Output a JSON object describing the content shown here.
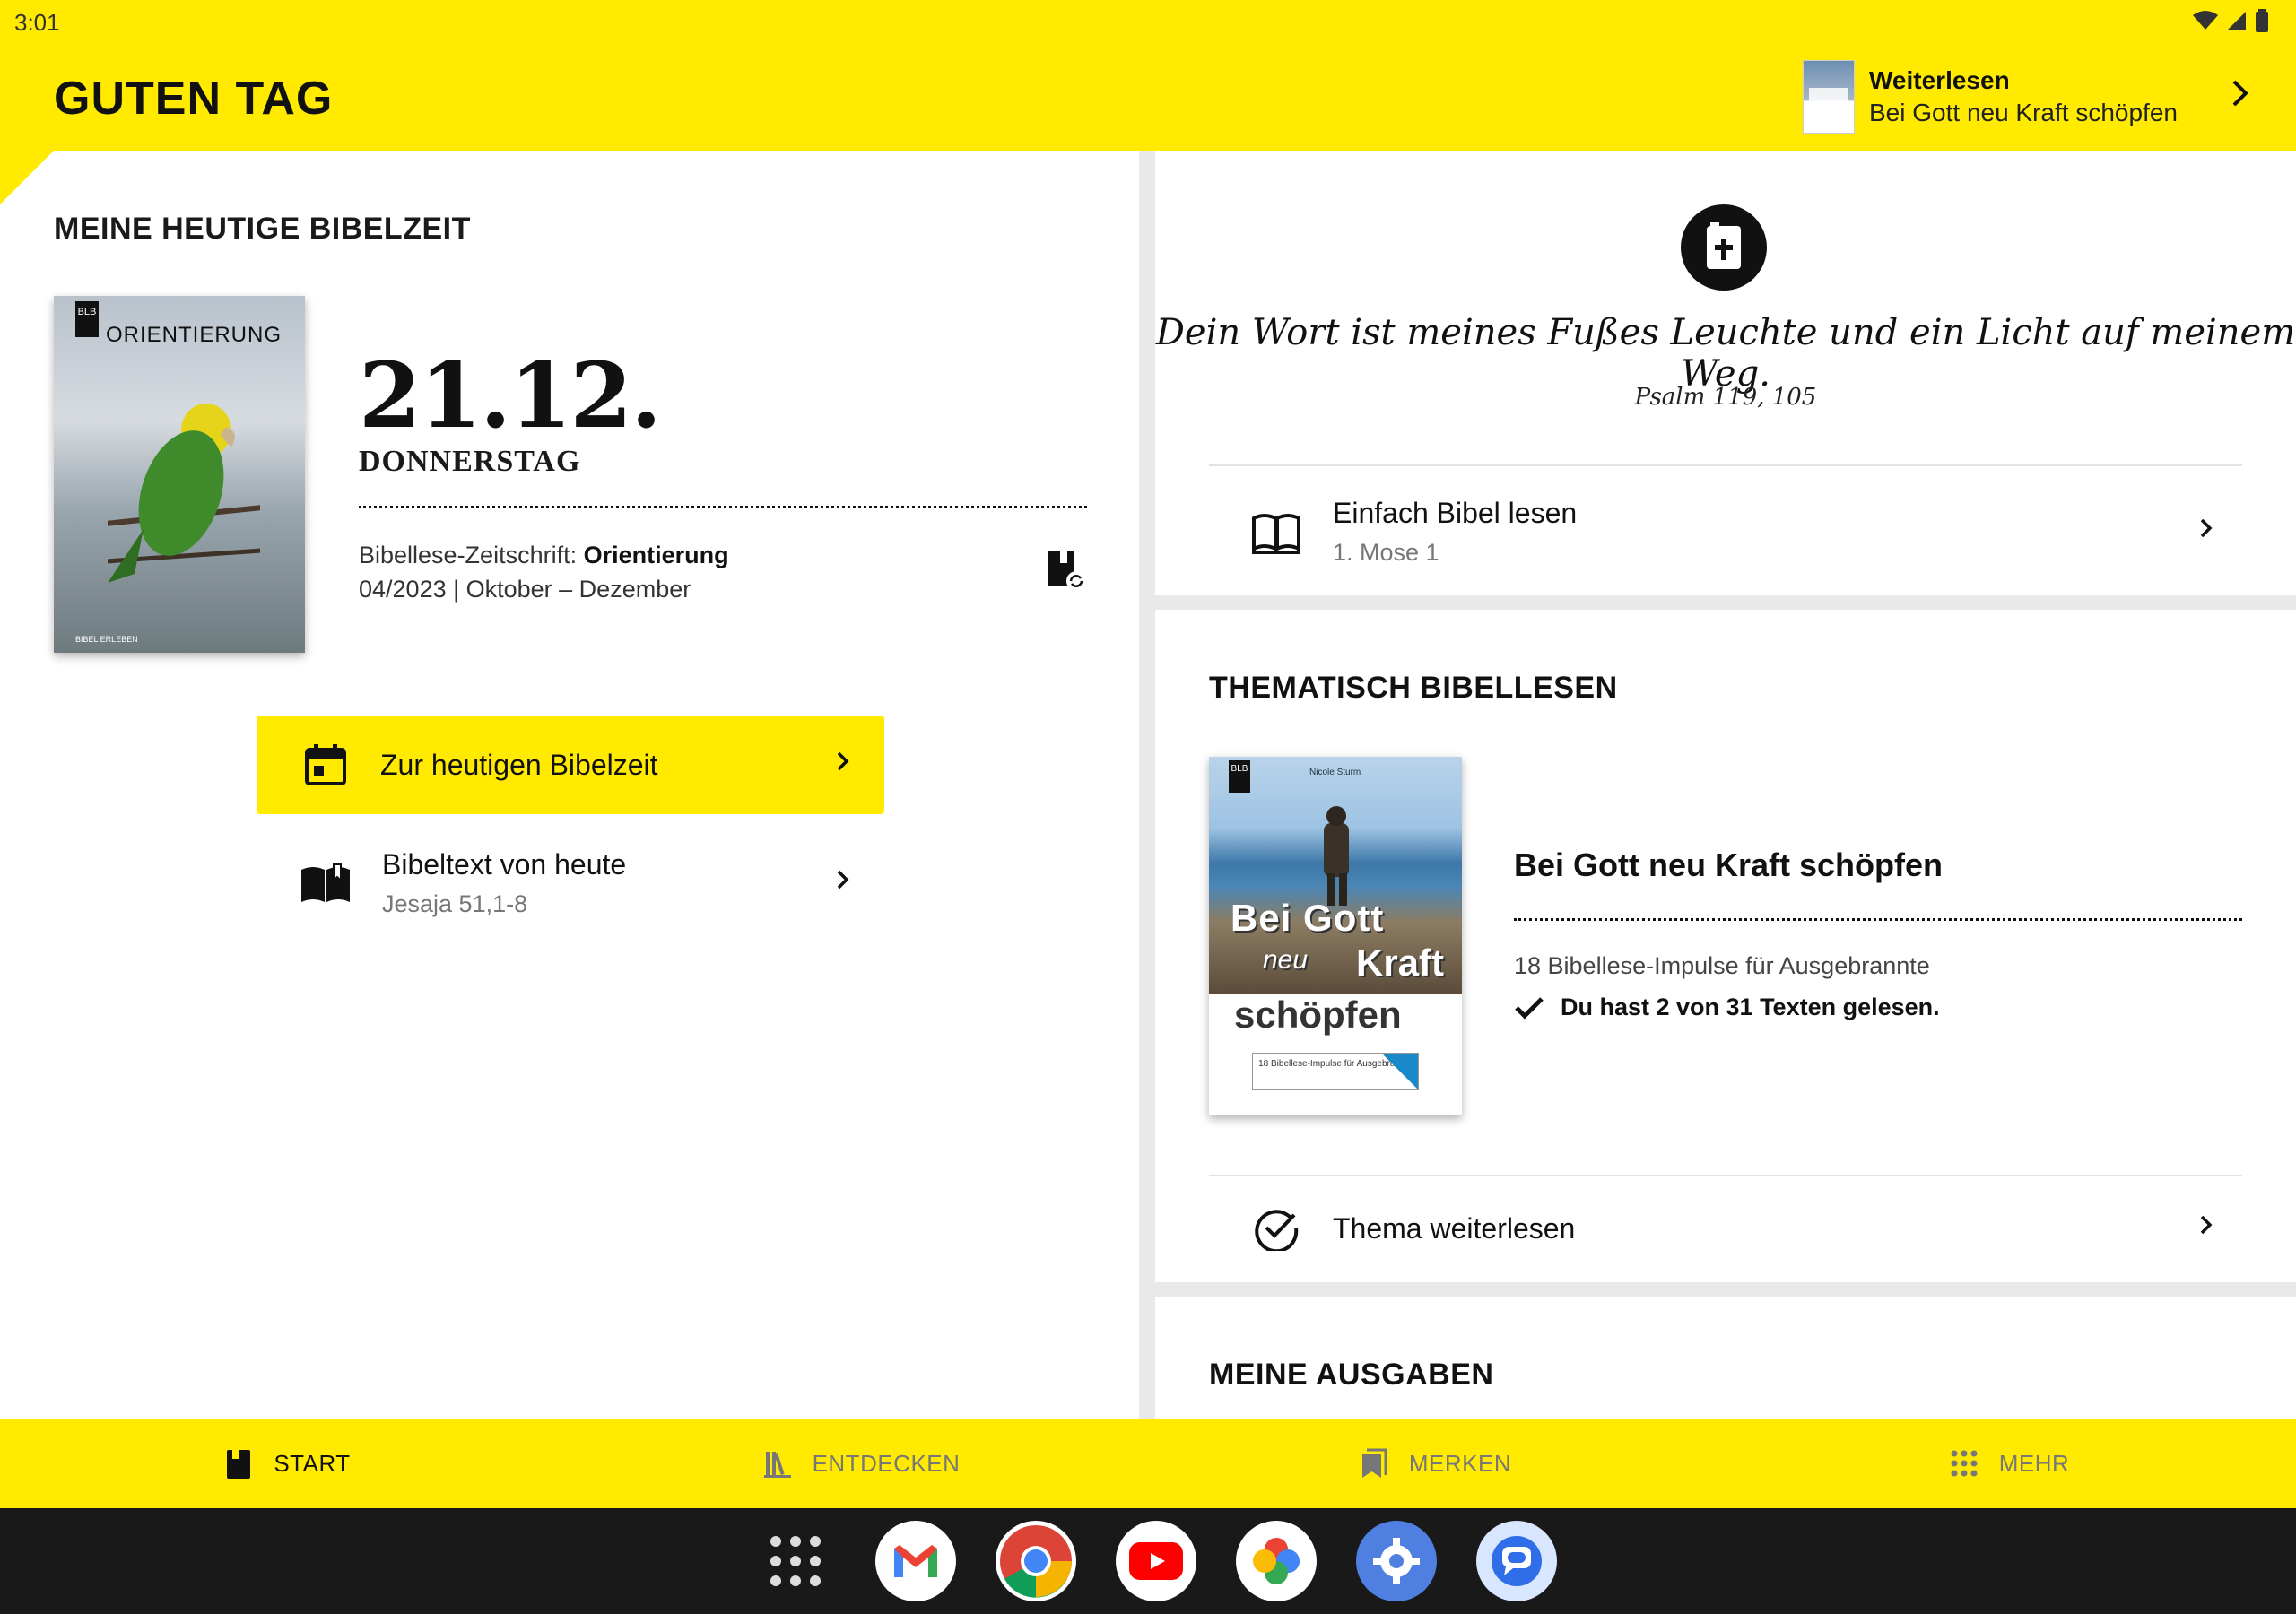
{
  "status": {
    "time": "3:01"
  },
  "header": {
    "greeting": "GUTEN TAG",
    "continue_title": "Weiterlesen",
    "continue_book": "Bei Gott neu Kraft schöpfen"
  },
  "today": {
    "section_title": "MEINE HEUTIGE BIBELZEIT",
    "cover_blb": "BLB",
    "cover_title": "ORIENTIERUNG",
    "cover_footer": "BIBEL ERLEBEN",
    "date": "21.12.",
    "weekday": "DONNERSTAG",
    "magazine_prefix": "Bibellese-Zeitschrift: ",
    "magazine_name": "Orientierung",
    "issue": "04/2023 | Oktober – Dezember",
    "button_label": "Zur heutigen Bibelzeit",
    "text_title": "Bibeltext von heute",
    "text_ref": "Jesaja 51,1-8"
  },
  "verse": {
    "text": "Dein Wort ist meines Fußes Leuchte und ein Licht auf meinem Weg.",
    "ref": "Psalm 119, 105",
    "read_title": "Einfach Bibel lesen",
    "read_ref": "1. Mose 1"
  },
  "thematic": {
    "section_title": "THEMATISCH BIBELLESEN",
    "book_blb": "BLB",
    "book_author": "Nicole Sturm",
    "book_word1": "Bei Gott",
    "book_word2": "neu",
    "book_word3": "Kraft",
    "book_word4": "schöpfen",
    "book_box": "18 Bibellese-Impulse für Ausgebrannte",
    "title": "Bei Gott neu Kraft schöpfen",
    "description": "18 Bibellese-Impulse für Ausgebrannte",
    "progress": "Du hast 2 von 31 Texten gelesen.",
    "continue_label": "Thema weiterlesen"
  },
  "editions": {
    "section_title": "MEINE AUSGABEN"
  },
  "nav": {
    "start": "START",
    "discover": "ENTDECKEN",
    "bookmarks": "MERKEN",
    "more": "MEHR"
  },
  "colors": {
    "accent": "#ffea00",
    "taskbar": "#191919"
  },
  "dock_apps": [
    "apps-grid-icon",
    "gmail-icon",
    "chrome-icon",
    "youtube-icon",
    "photos-icon",
    "settings-icon",
    "messages-icon"
  ]
}
